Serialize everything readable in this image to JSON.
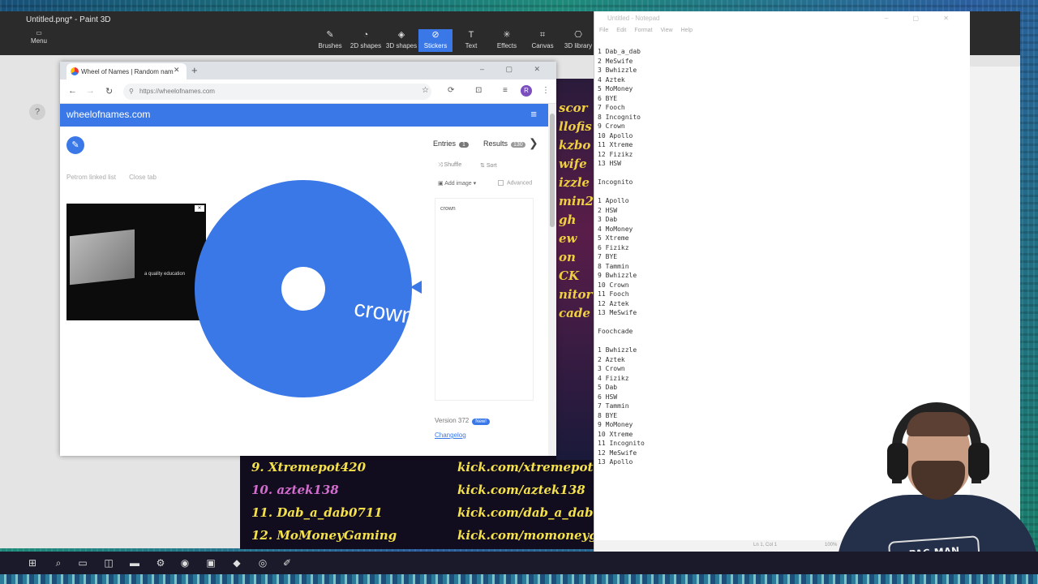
{
  "paint": {
    "title": "Untitled.png* - Paint 3D",
    "menu_label": "Menu",
    "tools": [
      {
        "label": "Brushes",
        "icon": "brush-icon",
        "glyph": "✎"
      },
      {
        "label": "2D shapes",
        "icon": "2d-shapes-icon",
        "glyph": "◔"
      },
      {
        "label": "3D shapes",
        "icon": "3d-shapes-icon",
        "glyph": "◈"
      },
      {
        "label": "Stickers",
        "icon": "stickers-icon",
        "glyph": "⊘",
        "active": true
      },
      {
        "label": "Text",
        "icon": "text-icon",
        "glyph": "T"
      },
      {
        "label": "Effects",
        "icon": "effects-icon",
        "glyph": "✳"
      },
      {
        "label": "Canvas",
        "icon": "canvas-icon",
        "glyph": "⌗"
      },
      {
        "label": "3D library",
        "icon": "3d-library-icon",
        "glyph": "⎔"
      }
    ],
    "help_label": "?"
  },
  "browser": {
    "tab_title": "Wheel of Names | Random nam",
    "url": "https://wheelofnames.com",
    "avatar_letter": "R"
  },
  "site": {
    "title": "wheelofnames.com",
    "meta_left": "Petrom linked list",
    "meta_right": "Close tab",
    "ad_text": "a quality education",
    "entries_label": "Entries",
    "entries_count": "1",
    "results_label": "Results",
    "results_count": "130",
    "shuffle_label": "Shuffle",
    "sort_label": "Sort",
    "add_image_label": "Add image",
    "advanced_label": "Advanced",
    "entries_text": "crown",
    "version_label": "Version 372",
    "new_badge": "New!",
    "changelog_label": "Changelog"
  },
  "wheel": {
    "label": "crown",
    "color": "#3b78e7"
  },
  "stream": {
    "handles": [
      "scor",
      "llofis",
      "kzbo",
      "wife",
      "izzle",
      "min2",
      "gh",
      "ew",
      "on",
      "CK",
      "nitor",
      "cade"
    ],
    "leaders": [
      {
        "name": "9. Xtremepot420",
        "url": "kick.com/xtremepot"
      },
      {
        "name": "10. aztek138",
        "url": "kick.com/aztek138",
        "purple": true
      },
      {
        "name": "11. Dab_a_dab0711",
        "url": "kick.com/dab_a_dab"
      },
      {
        "name": "12. MoMoneyGaming",
        "url": "kick.com/momoneyg"
      }
    ]
  },
  "notepad": {
    "title": "Untitled - Notepad",
    "menu": [
      "File",
      "Edit",
      "Format",
      "View",
      "Help"
    ],
    "lines": [
      "1 Dab_a_dab",
      "2 MeSwife",
      "3 Bwhizzle",
      "4 Aztek",
      "5 MoMoney",
      "6 BYE",
      "7 Fooch",
      "8 Incognito",
      "9 Crown",
      "10 Apollo",
      "11 Xtreme",
      "12 Fizikz",
      "13 HSW",
      "",
      "Incognito",
      "",
      "1 Apollo",
      "2 HSW",
      "3 Dab",
      "4 MoMoney",
      "5 Xtreme",
      "6 Fizikz",
      "7 BYE",
      "8 Tammin",
      "9 Bwhizzle",
      "10 Crown",
      "11 Fooch",
      "12 Aztek",
      "13 MeSwife",
      "",
      "Foochcade",
      "",
      "1 Bwhizzle",
      "2 Aztek",
      "3 Crown",
      "4 Fizikz",
      "5 Dab",
      "6 HSW",
      "7 Tammin",
      "8 BYE",
      "9 MoMoney",
      "10 Xtreme",
      "11 Incognito",
      "12 MeSwife",
      "13 Apollo"
    ],
    "status_pos": "Ln 1, Col 1",
    "status_zoom": "100%"
  },
  "webcam": {
    "shirt_text": "PAC-MAN"
  },
  "taskbar": {
    "items": [
      {
        "icon": "windows-start-icon",
        "glyph": "⊞"
      },
      {
        "icon": "search-icon",
        "glyph": "⌕"
      },
      {
        "icon": "task-view-icon",
        "glyph": "▭"
      },
      {
        "icon": "store-icon",
        "glyph": "◫"
      },
      {
        "icon": "file-explorer-icon",
        "glyph": "▬"
      },
      {
        "icon": "settings-icon",
        "glyph": "⚙"
      },
      {
        "icon": "chrome-icon",
        "glyph": "◉"
      },
      {
        "icon": "app-icon",
        "glyph": "▣"
      },
      {
        "icon": "paint3d-icon",
        "glyph": "◆"
      },
      {
        "icon": "obs-icon",
        "glyph": "◎"
      },
      {
        "icon": "notepad-icon",
        "glyph": "✐"
      }
    ]
  }
}
